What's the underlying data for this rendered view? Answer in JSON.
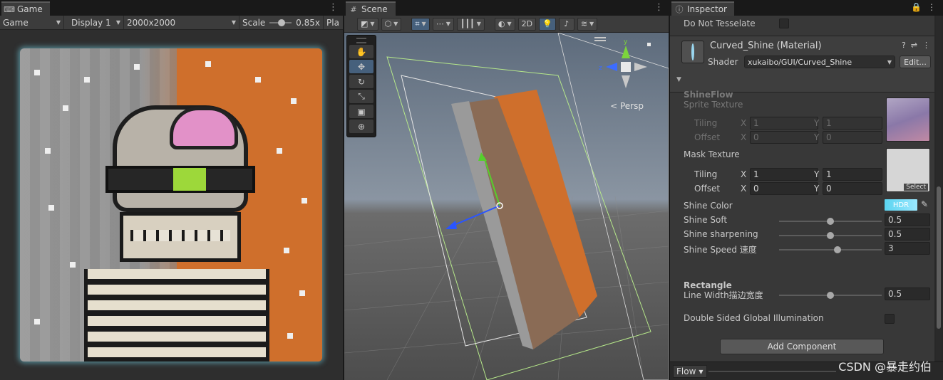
{
  "game": {
    "tab_label": "Game",
    "mode": "Game",
    "display": "Display 1",
    "resolution": "2000x2000",
    "scale_label": "Scale",
    "scale_value": "0.85x",
    "play_label": "Pla",
    "scale_level": 0.3
  },
  "scene": {
    "tab_label": "Scene",
    "toolbar": {
      "mode_2d": "2D"
    },
    "tools": [
      "hand-tool",
      "move-tool",
      "rotate-tool",
      "scale-tool",
      "rect-tool",
      "transform-tool"
    ],
    "persp_label": "< Persp",
    "axes": {
      "y": "y",
      "z": "z"
    }
  },
  "inspector": {
    "tab_label": "Inspector",
    "do_not_tesselate": "Do Not Tesselate",
    "material_name": "Curved_Shine (Material)",
    "shader_label": "Shader",
    "shader_value": "xukaibo/GUI/Curved_Shine",
    "edit_button": "Edit...",
    "shineflow_label": "ShineFlow",
    "sprite_texture_label": "Sprite Texture",
    "tiling_label": "Tiling",
    "offset_label": "Offset",
    "x_label": "X",
    "y_label": "Y",
    "sprite_tiling_x": "1",
    "sprite_tiling_y": "1",
    "sprite_offset_x": "0",
    "sprite_offset_y": "0",
    "mask_texture_label": "Mask Texture",
    "mask_tiling_x": "1",
    "mask_tiling_y": "1",
    "mask_offset_x": "0",
    "mask_offset_y": "0",
    "select_label": "Select",
    "shine_color_label": "Shine Color",
    "hdr_label": "HDR",
    "shine_soft_label": "Shine Soft",
    "shine_soft_value": "0.5",
    "shine_sharpening_label": "Shine sharpening",
    "shine_sharpening_value": "0.5",
    "shine_speed_label": "Shine Speed 速度",
    "shine_speed_value": "3",
    "rectangle_label": "Rectangle",
    "line_width_label": "Line Width描边宽度",
    "line_width_value": "0.5",
    "double_sided_label": "Double Sided Global Illumination",
    "add_component": "Add Component",
    "flow_button": "Flow",
    "accent_color": "#5bd4f0"
  },
  "watermark": "CSDN @暴走约伯"
}
